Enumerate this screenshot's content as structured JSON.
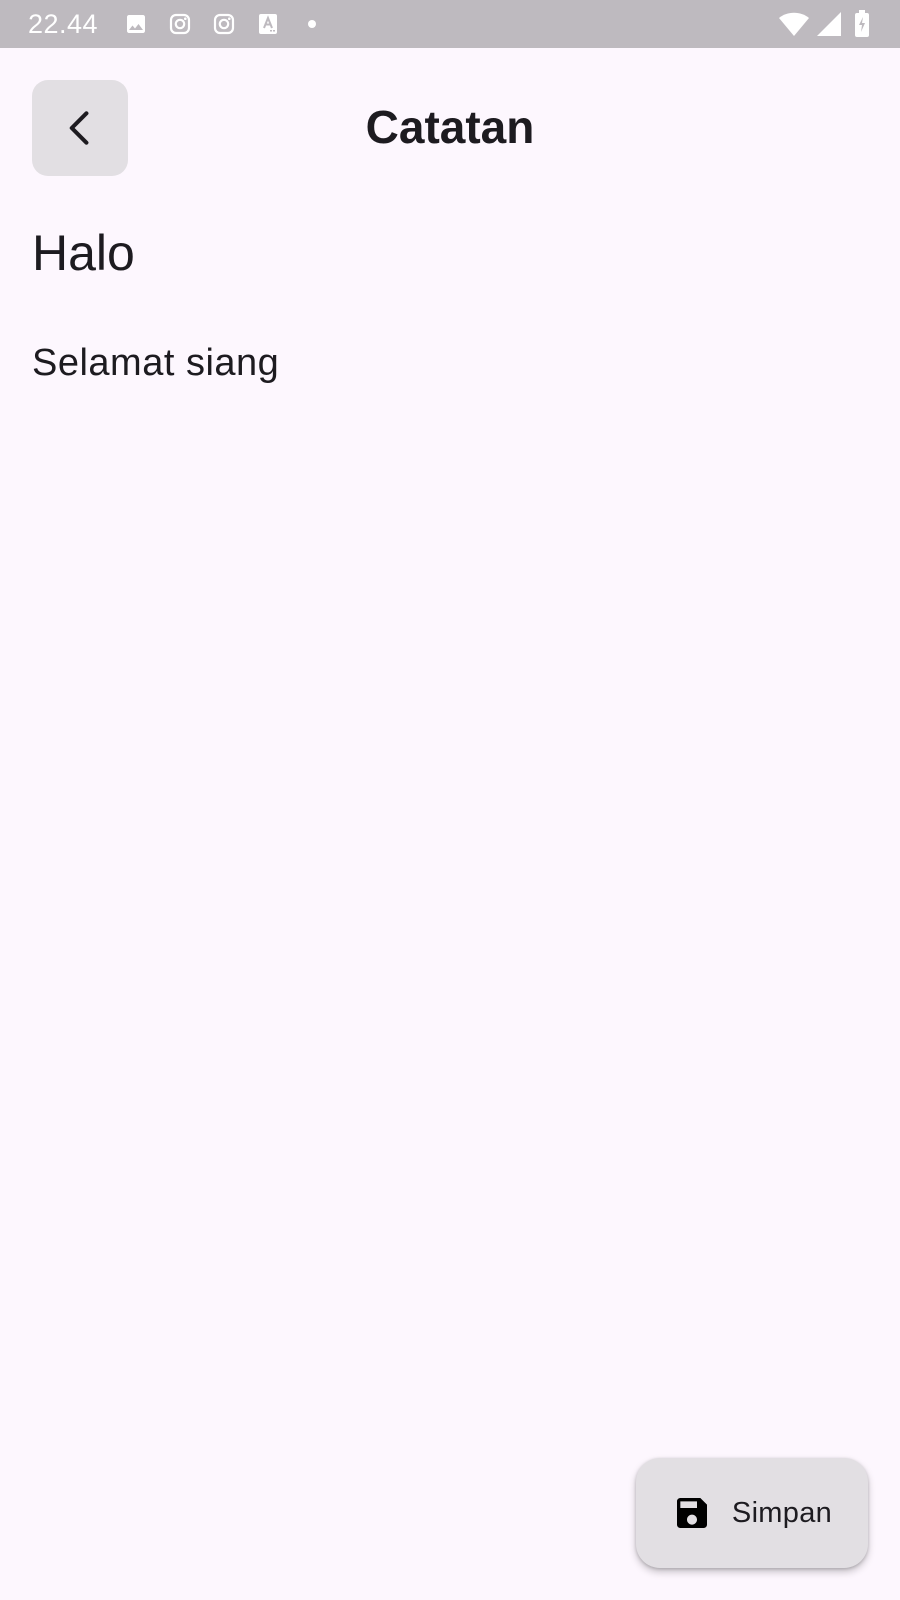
{
  "status_bar": {
    "time": "22.44",
    "icons": [
      "image-icon",
      "instagram-icon",
      "instagram-icon",
      "font-icon",
      "dot-icon",
      "wifi-icon",
      "signal-icon",
      "battery-icon"
    ]
  },
  "app_bar": {
    "title": "Catatan",
    "back_icon": "chevron-left-icon"
  },
  "note": {
    "title": "Halo",
    "body": "Selamat siang"
  },
  "fab": {
    "label": "Simpan",
    "icon": "save-icon"
  },
  "colors": {
    "background": "#fdf7fe",
    "status_bar": "#bebabf",
    "button_surface": "#e2dfe3",
    "text": "#1d1b20"
  }
}
